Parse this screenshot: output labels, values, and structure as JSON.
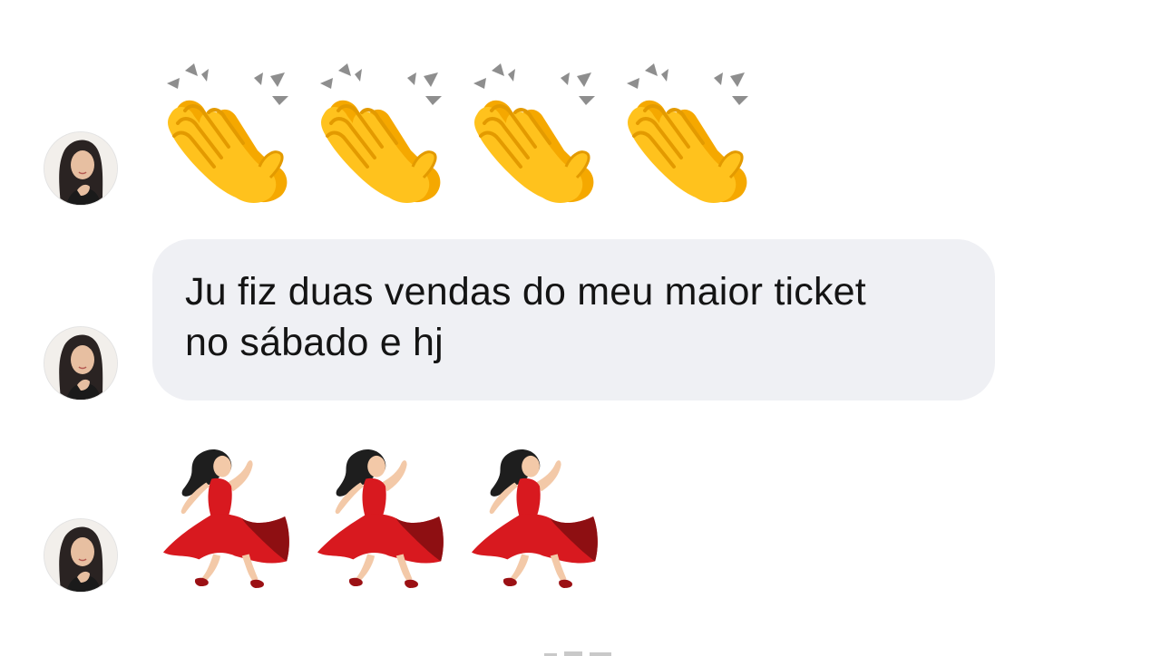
{
  "conversation": {
    "sender_avatar_alt": "contact profile photo",
    "messages": [
      {
        "type": "emoji",
        "emoji": "👏",
        "count": 4,
        "icon": "clapping-hands-icon"
      },
      {
        "type": "text",
        "text": "Ju fiz duas vendas do meu maior ticket\nno sábado e hj"
      },
      {
        "type": "emoji",
        "emoji": "💃",
        "count": 3,
        "icon": "dancing-woman-icon"
      }
    ]
  },
  "colors": {
    "background": "#ffffff",
    "bubble": "#eff0f4",
    "text": "#141414",
    "clap_yellow": "#ffc21d",
    "dress_red": "#d8191f"
  }
}
